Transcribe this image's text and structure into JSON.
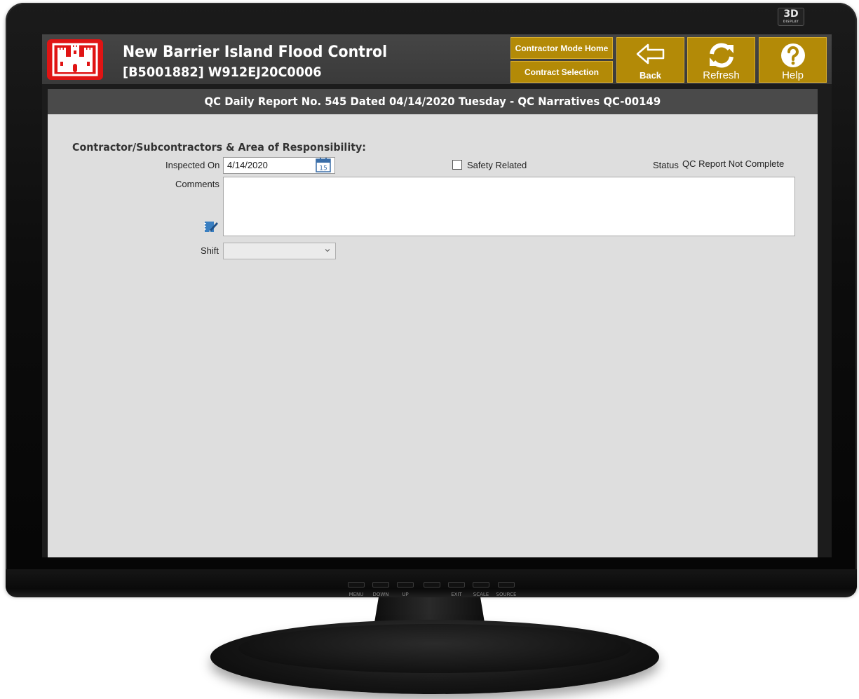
{
  "monitor": {
    "badge": "3D",
    "badge_sub": "DISPLAY",
    "buttons": [
      "MENU",
      "DOWN",
      "UP",
      "",
      "EXIT",
      "SCALE",
      "SOURCE"
    ]
  },
  "header": {
    "title": "New Barrier Island Flood Control",
    "subtitle": "[B5001882] W912EJ20C0006",
    "contractor_mode_home": "Contractor Mode Home",
    "contract_selection": "Contract Selection",
    "back_label": "Back",
    "refresh_label": "Refresh",
    "help_label": "Help",
    "logo_icon": "castle-icon",
    "accent": "#b38a07",
    "logo_color": "#e01414"
  },
  "report": {
    "title": "QC Daily Report No. 545 Dated 04/14/2020 Tuesday - QC Narratives QC-00149"
  },
  "form": {
    "section_heading": "Contractor/Subcontractors & Area of Responsibility:",
    "inspected_on_label": "Inspected On",
    "inspected_on_value": "4/14/2020",
    "calendar_day": "15",
    "safety_related_label": "Safety Related",
    "safety_related_checked": false,
    "status_label": "Status",
    "status_value": "QC Report Not Complete",
    "comments_label": "Comments",
    "comments_value": "",
    "shift_label": "Shift",
    "shift_value": ""
  }
}
